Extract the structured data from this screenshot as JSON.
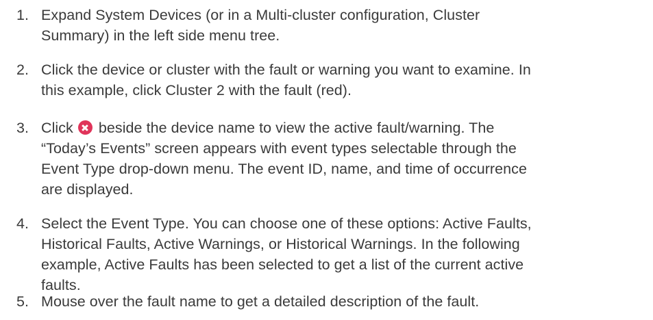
{
  "steps": [
    {
      "number": "1.",
      "lines": [
        "Expand System Devices (or in a Multi-cluster configuration, Cluster",
        "Summary) in the left side menu tree."
      ]
    },
    {
      "number": "2.",
      "lines": [
        "Click the device or cluster with the fault or warning you want to examine. In",
        "this example, click Cluster 2 with the fault (red)."
      ]
    },
    {
      "number": "3.",
      "line1_before_icon": "Click",
      "icon": "fault-icon",
      "line1_after_icon": "beside the device name to view the active fault/warning. The",
      "lines": [
        "“Today’s Events” screen appears with event types selectable through the",
        "Event Type drop-down menu. The event ID, name, and time of occurrence",
        "are displayed."
      ]
    },
    {
      "number": "4.",
      "lines": [
        "Select the Event Type. You can choose one of these options: Active Faults,",
        "Historical Faults, Active Warnings, or Historical Warnings. In the following",
        "example, Active Faults has been selected to get a list of the current active",
        "faults."
      ]
    },
    {
      "number": "5.",
      "lines": [
        "Mouse over the fault name to get a detailed description of the fault."
      ]
    }
  ]
}
